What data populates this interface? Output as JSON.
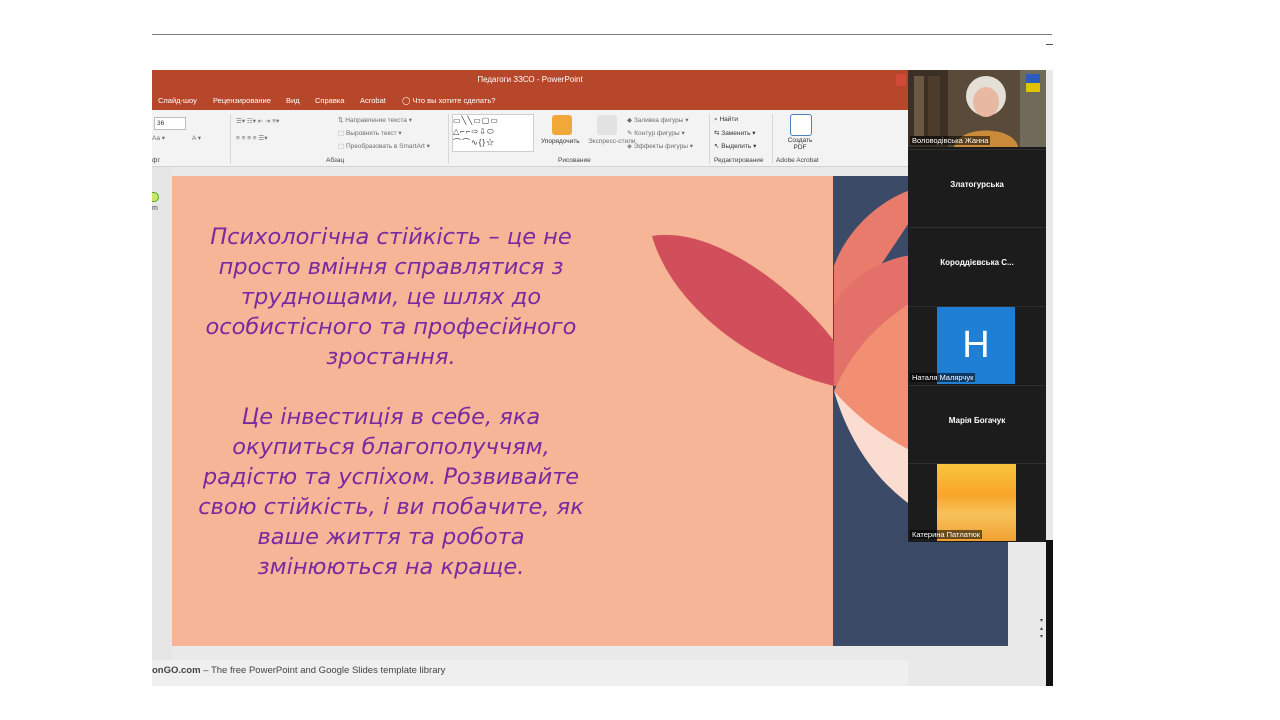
{
  "window": {
    "title": "Педагоги ЗЗСО  -  PowerPoint"
  },
  "tabs": [
    "Слайд-шоу",
    "Рецензирование",
    "Вид",
    "Справка",
    "Acrobat"
  ],
  "tell_me": "Что вы хотите сделать?",
  "ribbon": {
    "font_size": "36",
    "font_group": "фт",
    "paragraph_group": "Абзац",
    "text_direction": "Направление текста",
    "align_text": "Выровнять текст",
    "smartart": "Преобразовать в SmartArt",
    "arrange": "Упорядочить",
    "quick_styles": "Экспресс-стили",
    "shape_fill": "Заливка фигуры",
    "shape_outline": "Контур фигуры",
    "shape_effects": "Эффекты фигуры",
    "drawing_group": "Рисование",
    "find": "Найти",
    "replace": "Заменить",
    "select": "Выделить",
    "editing_group": "Редактирование",
    "create_pdf": "Создать PDF",
    "acrobat_group": "Adobe Acrobat"
  },
  "slide": {
    "paragraph1": "Психологічна стійкість – це не просто вміння справлятися з труднощами, це шлях до особистісного та професійного зростання.",
    "paragraph2": "Це інвестиція в себе, яка окупиться благополуччям, радістю та успіхом. Розвивайте свою стійкість, і ви побачите, як ваше життя та робота змінюються на краще.",
    "colors": {
      "background": "#f6b596",
      "text": "#7a2aa0",
      "dark_panel": "#3b4a66",
      "petal_red": "#d14f5a",
      "petal_coral": "#e97b6c",
      "petal_peach": "#f28f73",
      "petal_light": "#fbdcd0"
    }
  },
  "left_fragment": "m",
  "footer": {
    "brand": "onGO.com",
    "text": " – The free PowerPoint and Google Slides template library"
  },
  "participants": [
    {
      "name": "Воловодівська Жанна",
      "type": "video"
    },
    {
      "name": "Златогурська",
      "type": "name"
    },
    {
      "name": "Короддієвська С...",
      "type": "name"
    },
    {
      "name": "Наталя Малярчук",
      "type": "avatar",
      "initial": "Н"
    },
    {
      "name": "Марія Богачук",
      "type": "name"
    },
    {
      "name": "Катерина Патлатюк",
      "type": "image"
    }
  ]
}
